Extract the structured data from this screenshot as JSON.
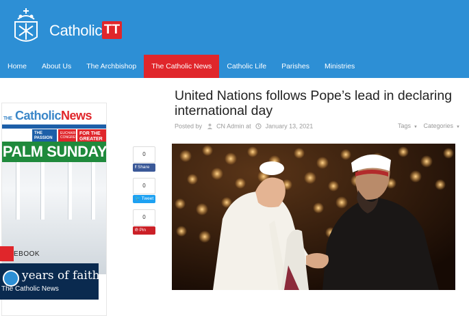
{
  "header": {
    "logo_text": "Catholic",
    "logo_badge": "TT",
    "brand_color": "#2d8fd5",
    "accent_color": "#e0262b"
  },
  "nav": {
    "items": [
      {
        "label": "Home"
      },
      {
        "label": "About Us"
      },
      {
        "label": "The Archbishop"
      },
      {
        "label": "The Catholic News",
        "active": true
      },
      {
        "label": "Catholic Life"
      },
      {
        "label": "Parishes"
      },
      {
        "label": "Ministries"
      }
    ]
  },
  "sidebar": {
    "cover": {
      "masthead_the": "THE",
      "masthead_catholic": "Catholic",
      "masthead_news": "News",
      "band_a": "THE PASSION",
      "band_b": "EUCHARISTIC CONGRESS",
      "band_c": "FOR THE GREATER GOOD",
      "headline": "PALM SUNDAY"
    },
    "facebook_label": "EBOOK",
    "fb_banner_line1": "years of faithful",
    "fb_banner_line2": "The Catholic News"
  },
  "share": {
    "facebook": {
      "count": "0",
      "label": "Share"
    },
    "twitter": {
      "count": "0",
      "label": "Tweet"
    },
    "pinterest": {
      "count": "0",
      "label": "Pin"
    }
  },
  "article": {
    "title": "United Nations follows Pope’s lead in declaring international day",
    "posted_by_label": "Posted by",
    "author": "CN Admin",
    "at_label": "at",
    "date": "January 13, 2021",
    "tags_label": "Tags",
    "categories_label": "Categories"
  },
  "icons": {
    "user": "user-icon",
    "clock": "clock-icon",
    "caret": "caret-down-icon",
    "facebook": "facebook-icon",
    "twitter": "twitter-icon",
    "pinterest": "pinterest-icon"
  }
}
